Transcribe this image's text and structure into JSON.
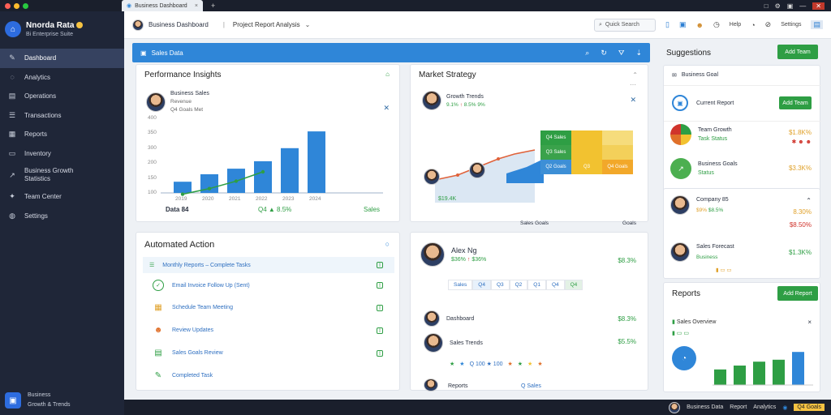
{
  "window": {
    "tab_title": "Business Dashboard",
    "controls": [
      "□",
      "⚙",
      "▣",
      "—",
      "✕"
    ]
  },
  "app": {
    "name": "Nnorda Rata",
    "subtitle": "Bi Enterprise Suite"
  },
  "sidebar": {
    "items": [
      {
        "label": "Dashboard",
        "icon": "pencil-icon"
      },
      {
        "label": "Analytics",
        "icon": "chat-icon"
      },
      {
        "label": "Operations",
        "icon": "briefcase-icon"
      },
      {
        "label": "Transactions",
        "icon": "list-icon"
      },
      {
        "label": "Reports",
        "icon": "grid-icon"
      },
      {
        "label": "Inventory",
        "icon": "doc-icon"
      },
      {
        "label": "Business Growth Statistics",
        "icon": "graph-icon"
      },
      {
        "label": "Team Center",
        "icon": "team-icon"
      },
      {
        "label": "Settings",
        "icon": "gear-icon"
      }
    ],
    "footer": {
      "line1": "Business",
      "line2": "Growth & Trends"
    }
  },
  "topbar": {
    "title": "Business Dashboard",
    "crumb": "Project Report Analysis",
    "search_placeholder": "Quick Search",
    "icons": [
      "grid-icon",
      "user-icon",
      "clock-icon",
      "help-icon",
      "alert-icon",
      "dark-mode-icon"
    ],
    "labels": {
      "a": "Help",
      "b": "Settings"
    }
  },
  "banner": {
    "label": "Sales Data",
    "icons": [
      "search-icon",
      "refresh-icon",
      "filter-icon",
      "download-icon"
    ]
  },
  "performance": {
    "title": "Performance Insights",
    "person": {
      "name": "Business Sales",
      "role": "Revenue",
      "sub": "Q4 Goals Met"
    },
    "y_ticks": [
      "400",
      "350",
      "300",
      "200",
      "150",
      "100"
    ],
    "x_ticks": [
      "2019",
      "2020",
      "2021",
      "2022",
      "2023",
      "2024"
    ],
    "footer_left": "Data 84",
    "footer_mid": "Q4 ▲ 8.5%",
    "footer_right": "Sales"
  },
  "chart_data": {
    "type": "bar",
    "categories": [
      "2019",
      "2020",
      "2021",
      "2022",
      "2023",
      "2024"
    ],
    "values": [
      60,
      100,
      130,
      170,
      240,
      330
    ],
    "line_values": [
      80,
      110,
      150,
      200,
      280,
      360
    ],
    "ylim": [
      0,
      400
    ]
  },
  "market": {
    "title": "Market Strategy",
    "person": {
      "name": "Growth Trends",
      "v1": "9.1%",
      "v2": "8.5%",
      "v3": "9%"
    },
    "footer_left": "$19.4K",
    "footer_right": "Sales",
    "heat": [
      [
        "Q4 Sales",
        "",
        ""
      ],
      [
        "Q3 Sales",
        "",
        ""
      ],
      [
        "Q2 Goals",
        "Q3",
        "Q4 Goals"
      ]
    ],
    "heat_colors": [
      [
        "#2e9e44",
        "#f2c230",
        "#f6dc7c"
      ],
      [
        "#3aa24b",
        "#f2c230",
        "#f3d05a"
      ],
      [
        "#3d8fd6",
        "#f2c230",
        "#f2a82a"
      ]
    ],
    "bottom_label": "Sales Goals",
    "bottom_right": "Goals"
  },
  "actions": {
    "title": "Automated Action",
    "rows": [
      {
        "label": "Monthly Reports – Complete Tasks",
        "icon": "list-icon"
      },
      {
        "label": "Email Invoice Follow Up (Sent)",
        "icon": "check-icon"
      },
      {
        "label": "Schedule Team Meeting",
        "icon": "calendar-icon"
      },
      {
        "label": "Review Updates",
        "icon": "person-icon"
      },
      {
        "label": "Sales Goals Review",
        "icon": "table-icon"
      },
      {
        "label": "Completed Task",
        "icon": "edit-icon"
      }
    ]
  },
  "sales_rep": {
    "name": "Alex Ng",
    "v1": "$36%",
    "v2": "$36%",
    "value_right": "$8.3%",
    "pills": [
      "Sales",
      "Q4",
      "Q3",
      "Q2",
      "Q1",
      "Q4",
      "Q4"
    ],
    "list": [
      {
        "name": "Dashboard",
        "value": "$8.3%"
      },
      {
        "name": "Sales Trends",
        "value": "$5.5%"
      }
    ],
    "stars_label": "Q 100 ★ 100",
    "foot_a": "Reports",
    "foot_b": "Q Sales"
  },
  "right": {
    "title": "Suggestions",
    "button": "Add Team",
    "subtitle": "Business Goal",
    "items": [
      {
        "title": "Current Report",
        "button": "Add Team"
      },
      {
        "title": "Team Growth",
        "sub": "Task Status",
        "value": "$1.8K%"
      },
      {
        "title": "Business Goals",
        "sub": "Status",
        "value": "$3.3K%"
      }
    ],
    "people": [
      {
        "name": "Company 85",
        "a": "$9%",
        "b": "$8.5%",
        "value": "8.30%",
        "value2": "$8.50%"
      },
      {
        "name": "Sales Forecast",
        "sub": "Business",
        "value": "$1.3K%"
      }
    ],
    "reports": {
      "title": "Reports",
      "button": "Add Report",
      "line1": "Sales Overview",
      "chart_values": [
        40,
        50,
        60,
        65,
        85
      ]
    }
  },
  "statusbar": {
    "user": "Business Data",
    "items": [
      "Report",
      "Analytics"
    ],
    "yellow": "Q4 Goals"
  },
  "colors": {
    "accent": "#2f86d8",
    "green": "#2e9e44",
    "sidebar": "#1f2638"
  }
}
